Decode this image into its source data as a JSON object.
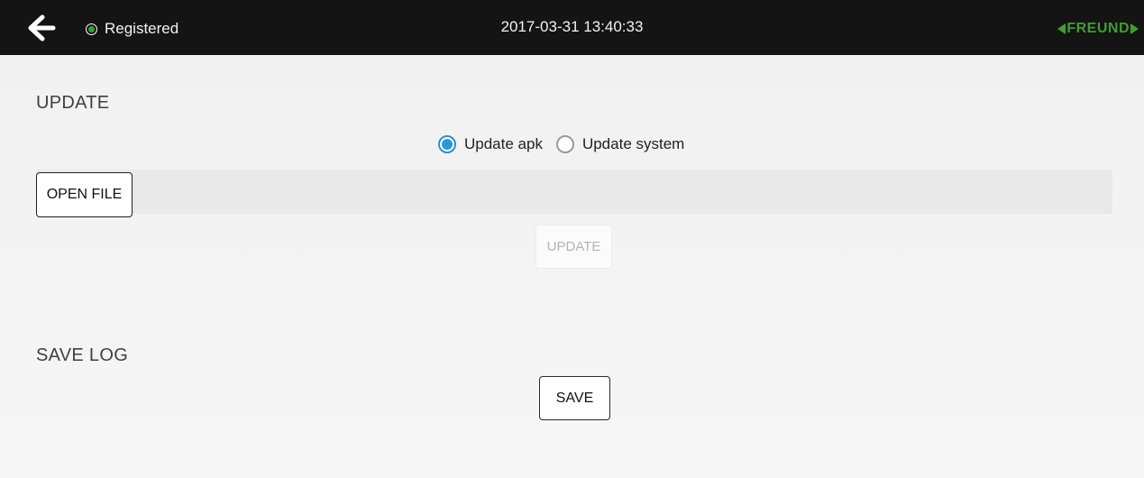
{
  "topbar": {
    "back_icon": "arrow-left-icon",
    "status_icon": "status-dot-icon",
    "status_text": "Registered",
    "status_color": "#2ea82e",
    "datetime": "2017-03-31 13:40:33",
    "logo_text": "FREUND",
    "logo_color": "#3f9f2f"
  },
  "update": {
    "title": "UPDATE",
    "options": [
      {
        "label": "Update apk",
        "checked": true
      },
      {
        "label": "Update system",
        "checked": false
      }
    ],
    "open_file_label": "OPEN FILE",
    "update_label": "UPDATE",
    "update_enabled": false,
    "accent_color": "#2a98d8"
  },
  "save_log": {
    "title": "SAVE LOG",
    "save_label": "SAVE"
  }
}
